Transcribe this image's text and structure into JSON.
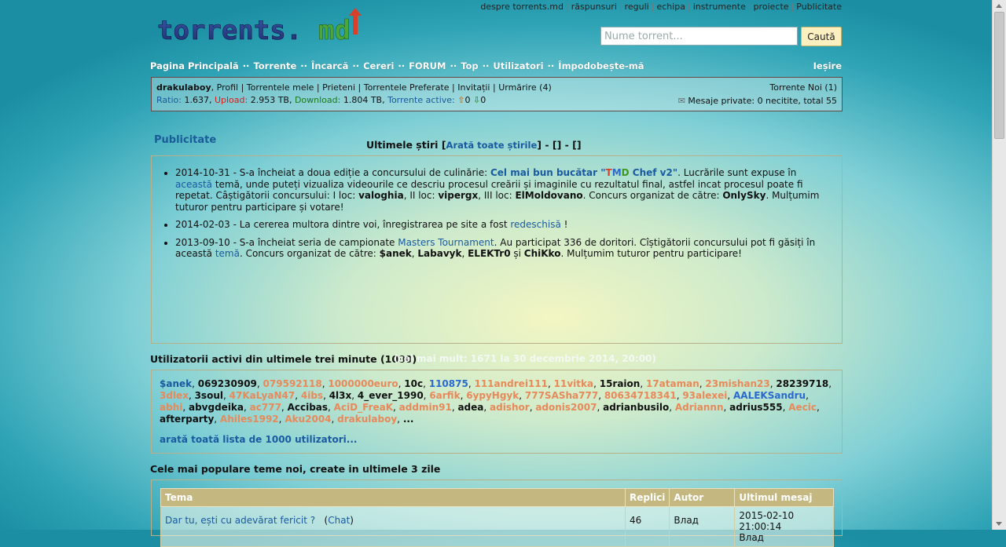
{
  "top_links": [
    "despre torrents.md",
    "răspunsuri",
    "reguli",
    "echipa",
    "instrumente",
    "proiecte",
    "Publicitate"
  ],
  "logo": {
    "text_main": "torrents.",
    "text_accent": "md"
  },
  "search": {
    "placeholder": "Nume torrent...",
    "button": "Caută"
  },
  "nav": [
    "Pagina Principală",
    "Torrente",
    "Încarcă",
    "Cereri",
    "FORUM",
    "Top",
    "Utilizatori",
    "Împodobește-mă"
  ],
  "logout": "Ieșire",
  "userbar": {
    "username": "drakulaboy",
    "links": ", Profil | Torrentele mele | Prieteni | Torrentele Preferate | Invitații | Urmărire (4)",
    "ratio_label": "Ratio:",
    "ratio": "1.637,",
    "upload_label": "Upload:",
    "upload": "2.953 TB,",
    "download_label": "Download:",
    "download": "1.804 TB,",
    "active_label": "Torrente active:",
    "active_up": "0",
    "active_down": "0",
    "new_torrents": "Torrente Noi (1)",
    "messages": "Mesaje private: 0 necitite, total 55"
  },
  "ad_label": "Publicitate",
  "news": {
    "title": "Ultimele știri",
    "show_all": "Arată toate știrile",
    "extra": " - [] - []",
    "items": [
      {
        "date": "2014-10-31",
        "t1": " - S-a încheiat a doua ediție a concursului de culinărie: ",
        "link": "Cel mai bun bucătar \"",
        "tmd_t": "T",
        "tmd_m": "M",
        "tmd_d": "D",
        "link2": " Chef v2\"",
        "t2": ". Lucrările sunt expuse în ",
        "link3": "această",
        "t3": " temă, unde puteți vizualiza videourile ce descriu procesul creării și imaginile cu rezultatul final, astfel incat procesul poate fi repetat. Câștigătorii concursului: I loc: ",
        "w1": "valoghia",
        "t4": ", II loc: ",
        "w2": "vipergx",
        "t5": ", III loc: ",
        "w3": "ElMoldovano",
        "t6": ". Concurs organizat de către: ",
        "org": "OnlySky",
        "t7": ". Mulțumim tuturor pentru participare și votare!"
      },
      {
        "date": "2014-02-03",
        "t1": " - La cererea multora dintre voi, înregistrarea pe site a fost ",
        "link": "redeschisă",
        "t2": " !"
      },
      {
        "date": "2013-09-10",
        "t1": " - S-a încheiat seria de campionate ",
        "link": "Masters Tournament",
        "t2": ". Au participat 336 de doritori. Cîștigătorii concursului pot fi găsiți în această ",
        "link2": "temă",
        "t3": ". Concurs organizat de către: ",
        "o1": "$anek",
        "o2": "Labavyk",
        "o3": "ELEKTr0",
        "o4": "ChiKko",
        "t4": ". Mulțumim tuturor pentru participare!"
      }
    ]
  },
  "active_users": {
    "title": "Utilizatorii activi din ultimele trei minute (1000)",
    "subtitle": "(cel mai mult: 1671 la 30 decembrie 2014, 20:00)",
    "users": [
      {
        "n": "$anek",
        "c": "#1a5aa0"
      },
      {
        "n": "069230909",
        "c": "#111"
      },
      {
        "n": "079592118",
        "c": "#e8895a"
      },
      {
        "n": "1000000euro",
        "c": "#e8895a"
      },
      {
        "n": "10c",
        "c": "#111"
      },
      {
        "n": "110875",
        "c": "#2a6ad0"
      },
      {
        "n": "111andrei111",
        "c": "#e8895a"
      },
      {
        "n": "11vitka",
        "c": "#e8895a"
      },
      {
        "n": "15raion",
        "c": "#111"
      },
      {
        "n": "17ataman",
        "c": "#e8895a"
      },
      {
        "n": "23mishan23",
        "c": "#e8895a"
      },
      {
        "n": "28239718",
        "c": "#111"
      },
      {
        "n": "3dlex",
        "c": "#e8895a"
      },
      {
        "n": "3soul",
        "c": "#111"
      },
      {
        "n": "47KaLyaN47",
        "c": "#e8895a"
      },
      {
        "n": "4ibs",
        "c": "#e8895a"
      },
      {
        "n": "4l3x",
        "c": "#111"
      },
      {
        "n": "4_ever_1990",
        "c": "#111"
      },
      {
        "n": "6arfik",
        "c": "#e8895a"
      },
      {
        "n": "6ypyHgyk",
        "c": "#e8895a"
      },
      {
        "n": "777SASha777",
        "c": "#e8895a"
      },
      {
        "n": "80634718341",
        "c": "#e8895a"
      },
      {
        "n": "93alexei",
        "c": "#e8895a"
      },
      {
        "n": "AALEKSandru",
        "c": "#2a6ad0"
      },
      {
        "n": "abhi",
        "c": "#e8895a"
      },
      {
        "n": "abvgdeika",
        "c": "#111"
      },
      {
        "n": "ac777",
        "c": "#e8895a"
      },
      {
        "n": "Accibas",
        "c": "#111"
      },
      {
        "n": "AciD_FreaK",
        "c": "#e8895a"
      },
      {
        "n": "addmin91",
        "c": "#e8895a"
      },
      {
        "n": "adea",
        "c": "#111"
      },
      {
        "n": "adishor",
        "c": "#e8895a"
      },
      {
        "n": "adonis2007",
        "c": "#e8895a"
      },
      {
        "n": "adrianbusilo",
        "c": "#111"
      },
      {
        "n": "Adriannn",
        "c": "#e8895a"
      },
      {
        "n": "adrius555",
        "c": "#111"
      },
      {
        "n": "Aecic",
        "c": "#e8895a"
      },
      {
        "n": "afterparty",
        "c": "#111"
      },
      {
        "n": "Ahiles1992",
        "c": "#e8895a"
      },
      {
        "n": "Aku2004",
        "c": "#e8895a"
      },
      {
        "n": "drakulaboy",
        "c": "#e8895a"
      }
    ],
    "ellipsis": "...",
    "show_all": "arată toată lista de 1000 utilizatori..."
  },
  "popular": {
    "title": "Cele mai populare teme noi, create in ultimele 3 zile",
    "headers": [
      "Tema",
      "Replici",
      "Autor",
      "Ultimul mesaj"
    ],
    "rows": [
      {
        "topic": "Dar tu, ești cu adevărat fericit ?",
        "forum": "Chat",
        "replies": "46",
        "author": "Влад",
        "last": "2015-02-10 21:00:14",
        "last_by": "Влад"
      }
    ]
  }
}
